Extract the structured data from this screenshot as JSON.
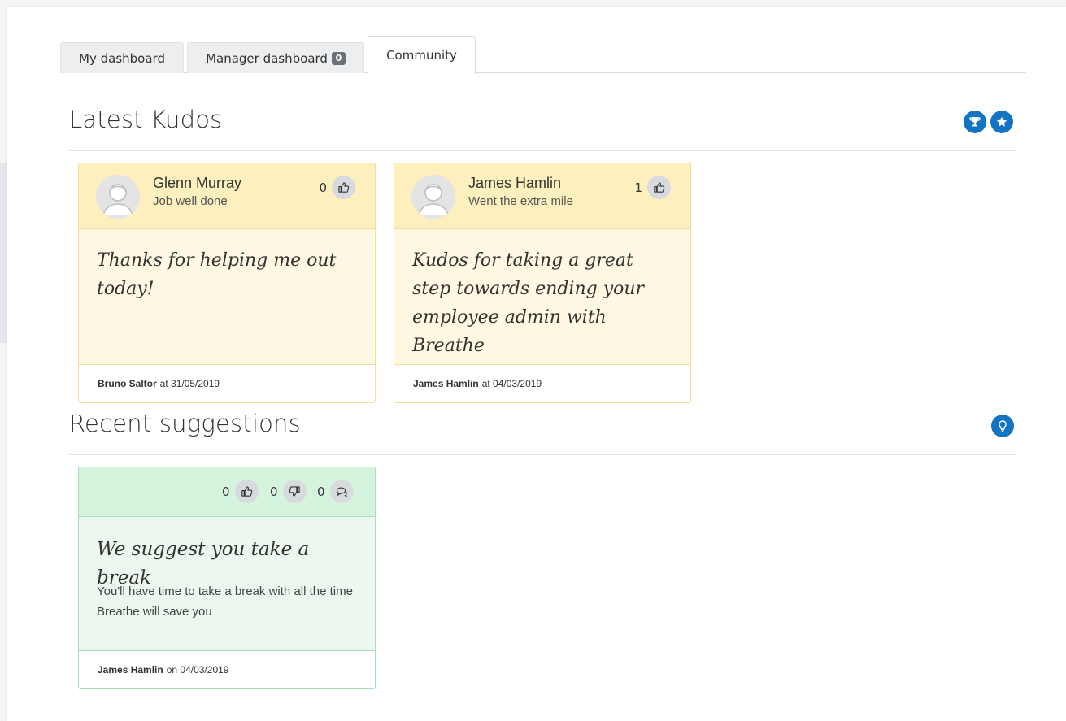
{
  "tabs": [
    {
      "label": "My dashboard"
    },
    {
      "label": "Manager dashboard",
      "badge": "0"
    },
    {
      "label": "Community",
      "active": true
    }
  ],
  "kudos_section": {
    "title": "Latest Kudos",
    "actions": [
      "trophy-icon",
      "star-icon"
    ]
  },
  "kudos": [
    {
      "name": "Glenn Murray",
      "reason": "Job well done",
      "likes": "0",
      "message": "Thanks for helping me out today!",
      "author": "Bruno Saltor",
      "date_text": "at 31/05/2019"
    },
    {
      "name": "James Hamlin",
      "reason": "Went the extra mile",
      "likes": "1",
      "message": "Kudos for taking a great step towards ending your employee admin with Breathe",
      "author": "James Hamlin",
      "date_text": "at 04/03/2019"
    }
  ],
  "suggestions_section": {
    "title": "Recent suggestions",
    "actions": [
      "lightbulb-icon"
    ]
  },
  "suggestions": [
    {
      "likes": "0",
      "dislikes": "0",
      "comments": "0",
      "title": "We suggest you take a break",
      "body": "You'll have time to take a break with all the time Breathe will save you",
      "author": "James Hamlin",
      "date_text": "on 04/03/2019"
    }
  ],
  "colors": {
    "accent": "#1474c4",
    "kudos_header": "#fdefbe",
    "kudos_body": "#fff9e3",
    "suggestion_header": "#d4f4dd",
    "suggestion_body": "#ecf8ef"
  }
}
